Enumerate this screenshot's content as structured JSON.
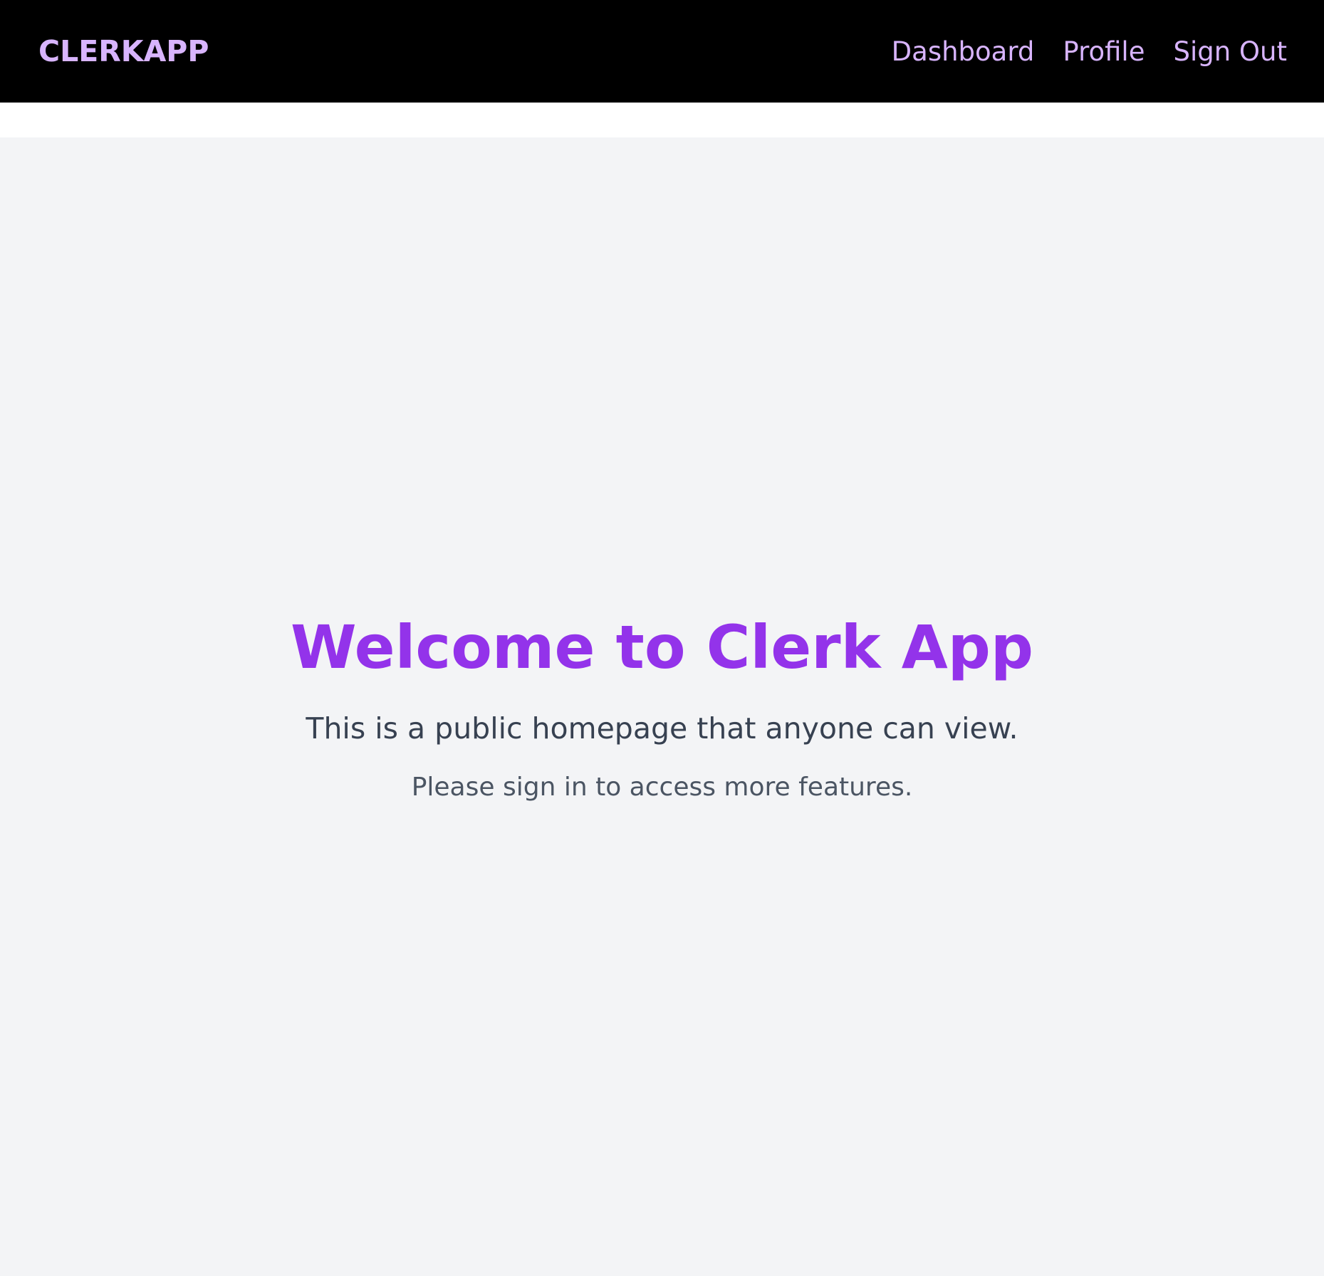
{
  "header": {
    "brand": "CLERKAPP",
    "nav": [
      {
        "label": "Dashboard"
      },
      {
        "label": "Profile"
      },
      {
        "label": "Sign Out"
      }
    ]
  },
  "hero": {
    "title": "Welcome to Clerk App",
    "subtitle": "This is a public homepage that anyone can view.",
    "note": "Please sign in to access more features."
  },
  "colors": {
    "navbar_bg": "#000000",
    "nav_text": "#d8b4fe",
    "title": "#9333ea",
    "page_bg": "#f3f4f6"
  }
}
